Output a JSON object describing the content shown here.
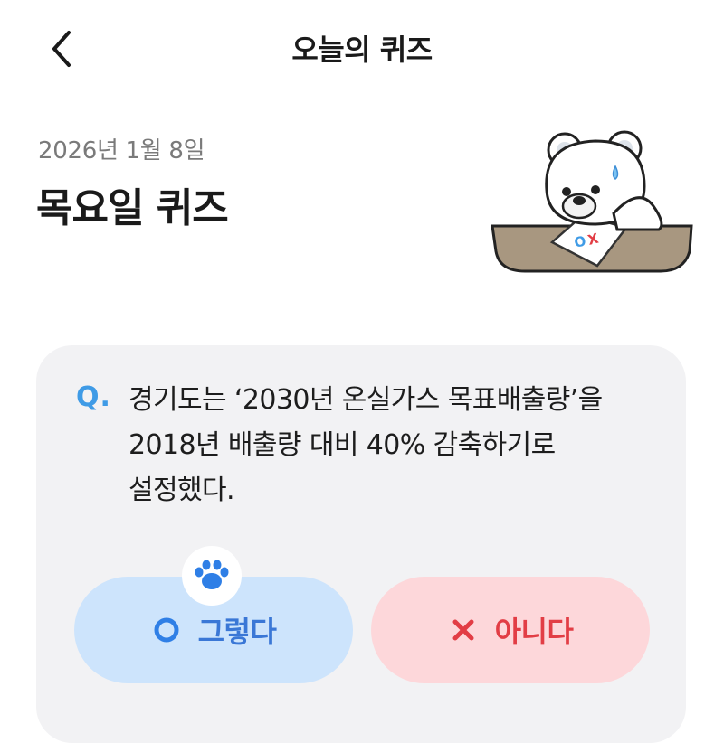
{
  "header": {
    "title": "오늘의 퀴즈",
    "back_icon": "chevron-left-icon"
  },
  "quiz": {
    "date": "2026년 1월 8일",
    "day_title": "목요일 퀴즈",
    "question_marker": "Q.",
    "question_lines": [
      "경기도는 ‘2030년 온실가스 목표배출량’을",
      "2018년 배출량 대비 40% 감축하기로",
      "설정했다."
    ]
  },
  "mascot": {
    "icon": "polar-bear-mascot",
    "sheet_text": "OX"
  },
  "answers": {
    "yes_label": "그렇다",
    "no_label": "아니다",
    "yes_icon": "circle-o-icon",
    "no_icon": "x-mark-icon",
    "paw_icon": "paw-icon"
  },
  "colors": {
    "accent_blue": "#3f9be6",
    "yes_bg": "#cde4fc",
    "yes_fg": "#3a77d6",
    "no_bg": "#fdd7da",
    "no_fg": "#e23d45",
    "card_bg": "#f2f2f4"
  }
}
